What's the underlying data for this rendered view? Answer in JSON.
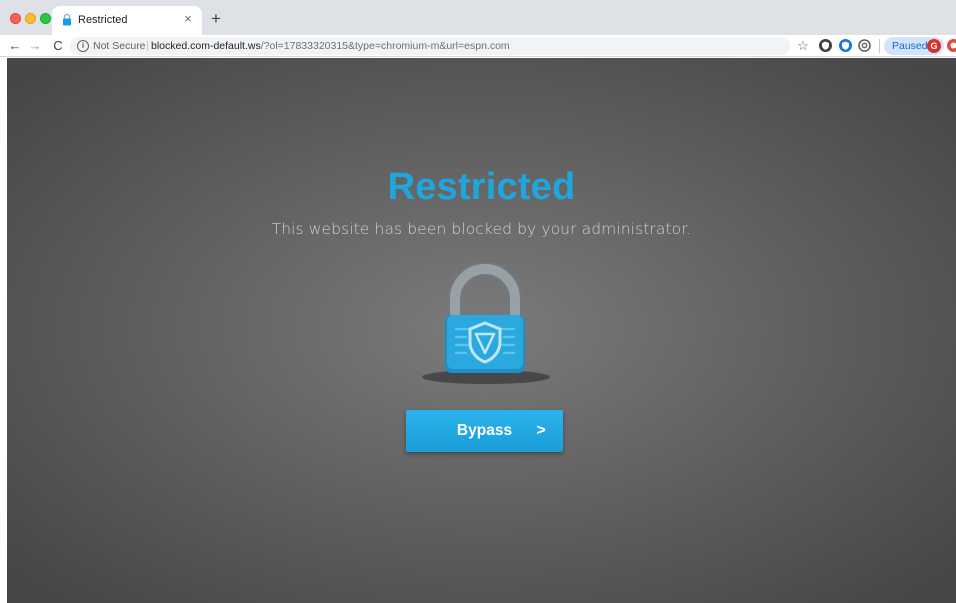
{
  "browser": {
    "tab": {
      "title": "Restricted",
      "close_glyph": "×",
      "icon": "lock-icon"
    },
    "new_tab_glyph": "+",
    "nav": {
      "back_glyph": "←",
      "forward_glyph": "→",
      "reload_glyph": "C"
    },
    "omnibox": {
      "info_glyph": "i",
      "security_label": "Not Secure",
      "url_host": "blocked.com-default.ws",
      "url_rest": "/?ol=17833320315&type=chromium-m&url=espn.com"
    },
    "toolbar": {
      "star_glyph": "☆",
      "profile_label": "Paused",
      "avatar_letter": "G"
    }
  },
  "page": {
    "title": "Restricted",
    "subtitle": "This website has been blocked by your administrator.",
    "bypass_button": {
      "label": "Bypass",
      "chevron": ">"
    }
  },
  "colors": {
    "accent": "#1fa6df",
    "button": "#22a9e3",
    "background": "#5e5e5e",
    "lock_shackle": "#9a9a9a",
    "lock_body": "#2aa8e0"
  }
}
